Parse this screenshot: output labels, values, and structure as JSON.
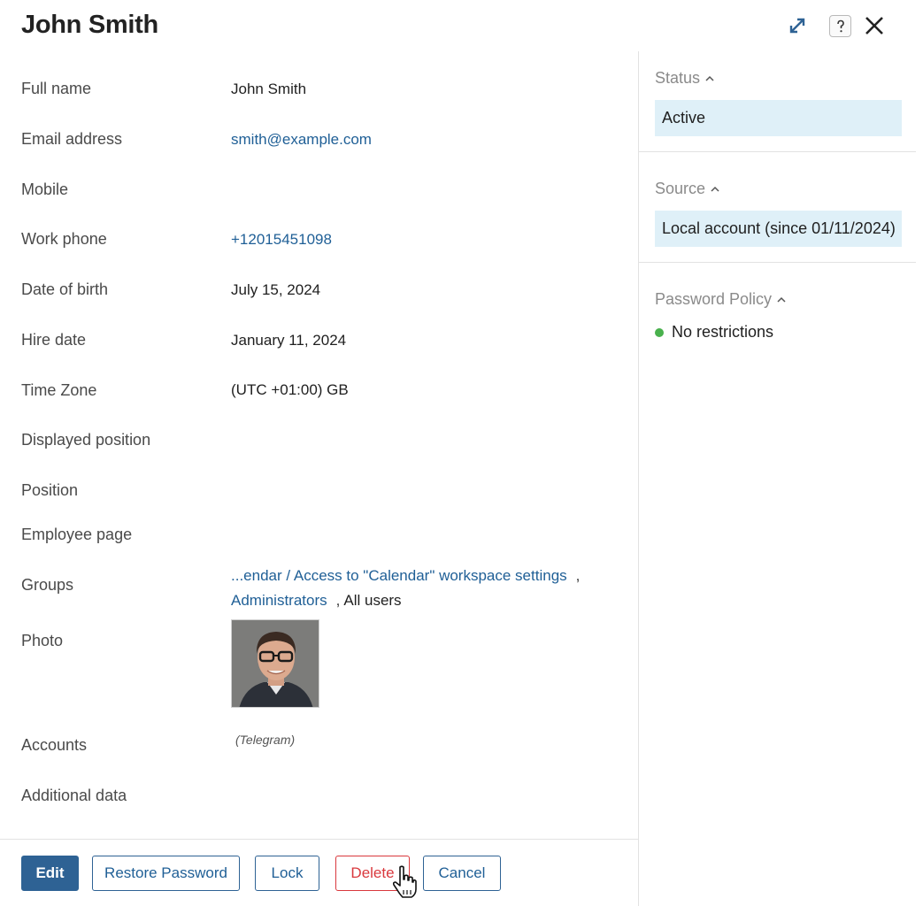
{
  "header": {
    "title": "John Smith",
    "icons": [
      "expand-icon",
      "help-icon",
      "close-icon"
    ]
  },
  "fields": {
    "full_name": {
      "label": "Full name",
      "value": "John Smith"
    },
    "email": {
      "label": "Email address",
      "value": "smith@example.com"
    },
    "mobile": {
      "label": "Mobile",
      "value": ""
    },
    "work_phone": {
      "label": "Work phone",
      "value": "+12015451098"
    },
    "date_of_birth": {
      "label": "Date of birth",
      "value": "July 15, 2024"
    },
    "hire_date": {
      "label": "Hire date",
      "value": "January 11, 2024"
    },
    "time_zone": {
      "label": "Time Zone",
      "value": "(UTC +01:00) GB"
    },
    "displayed_position": {
      "label": "Displayed position",
      "value": ""
    },
    "position": {
      "label": "Position",
      "value": ""
    },
    "employee_page": {
      "label": "Employee page",
      "value": ""
    },
    "groups": {
      "label": "Groups",
      "items": [
        "...endar / Access to \"Calendar\" workspace settings",
        "Administrators",
        "All users"
      ],
      "separator": ","
    },
    "photo": {
      "label": "Photo"
    },
    "accounts": {
      "label": "Accounts",
      "value": "(Telegram)"
    },
    "additional_data": {
      "label": "Additional data"
    }
  },
  "buttons": {
    "edit": "Edit",
    "restore_password": "Restore Password",
    "lock": "Lock",
    "delete": "Delete",
    "cancel": "Cancel"
  },
  "sidebar": {
    "status": {
      "title": "Status",
      "value": "Active"
    },
    "source": {
      "title": "Source",
      "value": "Local account (since 01/11/2024)"
    },
    "password_policy": {
      "title": "Password Policy",
      "value": "No restrictions",
      "indicator_color": "#49b14d"
    }
  },
  "colors": {
    "accent": "#2e6294",
    "link": "#1f5f96",
    "danger": "#d9383d",
    "highlight_box": "#dff0f8"
  }
}
